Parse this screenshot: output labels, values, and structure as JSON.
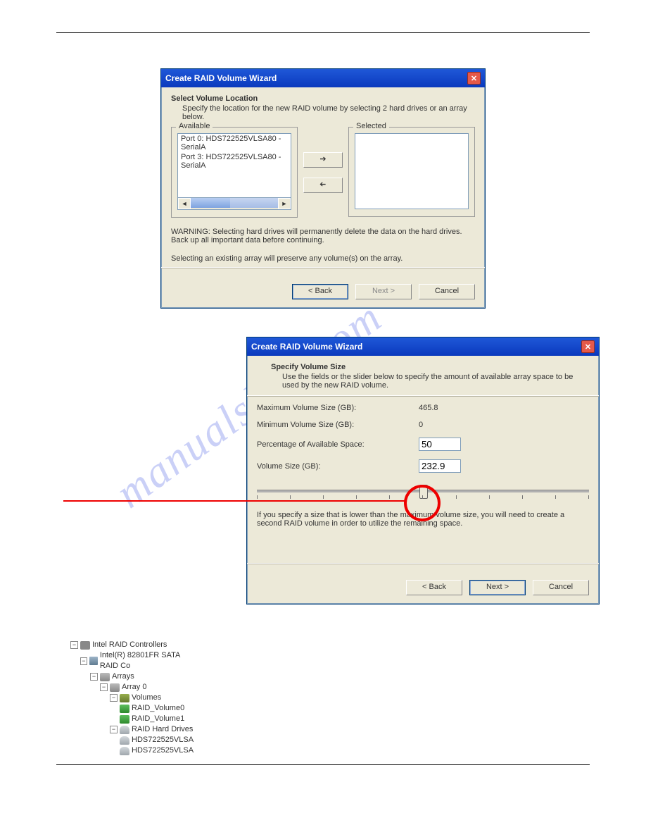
{
  "watermark": "manualslive.com",
  "dialog1": {
    "title": "Create RAID Volume Wizard",
    "heading": "Select Volume Location",
    "subheading": "Specify the location for the new RAID volume by selecting 2 hard drives or an array below.",
    "available_label": "Available",
    "selected_label": "Selected",
    "available_items": [
      "Port 0: HDS722525VLSA80 - SerialA",
      "Port 3: HDS722525VLSA80 - SerialA"
    ],
    "warning": "WARNING: Selecting hard drives will permanently delete the data on the hard drives. Back up all important data before continuing.",
    "note": "Selecting an existing array will preserve any volume(s) on the array.",
    "buttons": {
      "back": "< Back",
      "next": "Next >",
      "cancel": "Cancel"
    }
  },
  "dialog2": {
    "title": "Create RAID Volume Wizard",
    "heading": "Specify Volume Size",
    "subheading": "Use the fields or the slider below to specify the amount of available array space to be used by the new RAID volume.",
    "fields": {
      "max_label": "Maximum Volume Size (GB):",
      "max_value": "465.8",
      "min_label": "Minimum Volume Size (GB):",
      "min_value": "0",
      "pct_label": "Percentage of Available Space:",
      "pct_value": "50",
      "size_label": "Volume Size (GB):",
      "size_value": "232.9"
    },
    "slider_percent": 50,
    "note": "If you specify a size that is lower than the maximum volume size, you will need to create a second RAID volume in order to utilize the remaining space.",
    "buttons": {
      "back": "< Back",
      "next": "Next >",
      "cancel": "Cancel"
    }
  },
  "tree": {
    "n0": "Intel RAID Controllers",
    "n1": "Intel(R) 82801FR SATA RAID Co",
    "n2": "Arrays",
    "n3": "Array 0",
    "n4": "Volumes",
    "n5": "RAID_Volume0",
    "n6": "RAID_Volume1",
    "n7": "RAID Hard Drives",
    "n8": "HDS722525VLSA",
    "n9": "HDS722525VLSA"
  }
}
